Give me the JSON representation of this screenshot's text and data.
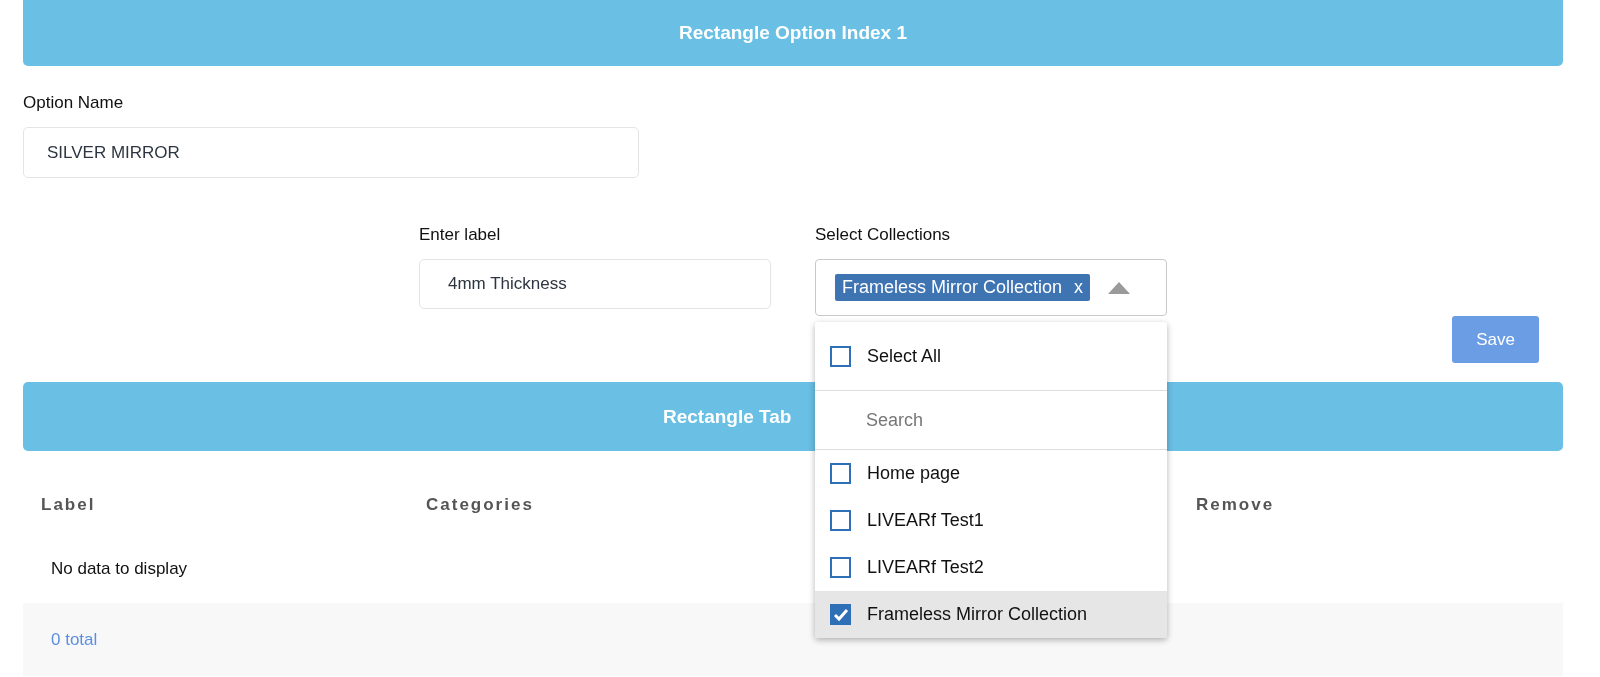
{
  "option_header": {
    "title": "Rectangle Option Index 1"
  },
  "option_name": {
    "label": "Option Name",
    "value": "SILVER MIRROR"
  },
  "label_field": {
    "label": "Enter label",
    "value": "4mm Thickness"
  },
  "collections": {
    "label": "Select Collections",
    "expanded": true,
    "chips": [
      {
        "text": "Frameless Mirror Collection",
        "remove": "x"
      }
    ],
    "select_all": {
      "label": "Select All",
      "checked": false
    },
    "search": {
      "placeholder": "Search"
    },
    "options": [
      {
        "label": "Home page",
        "checked": false,
        "selected": false
      },
      {
        "label": "LIVEARf Test1",
        "checked": false,
        "selected": false
      },
      {
        "label": "LIVEARf Test2",
        "checked": false,
        "selected": false
      },
      {
        "label": "Frameless Mirror Collection",
        "checked": true,
        "selected": true
      }
    ]
  },
  "save_button": "Save",
  "table_header": {
    "title": "Rectangle Tab"
  },
  "table": {
    "columns": [
      "Label",
      "Categories",
      "Remove"
    ],
    "empty_text": "No data to display",
    "footer": "0 total"
  }
}
